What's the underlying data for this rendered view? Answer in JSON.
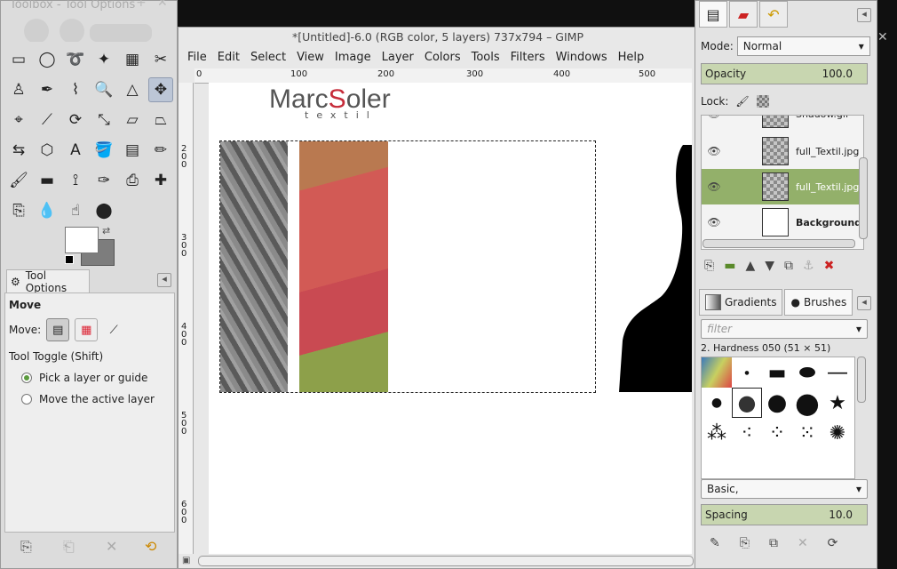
{
  "toolbox": {
    "title": "Toolbox - Tool Options",
    "tools": [
      {
        "name": "rect-select-icon",
        "glyph": "▭"
      },
      {
        "name": "ellipse-select-icon",
        "glyph": "◯"
      },
      {
        "name": "free-select-icon",
        "glyph": "➰"
      },
      {
        "name": "fuzzy-select-icon",
        "glyph": "✦"
      },
      {
        "name": "color-select-icon",
        "glyph": "▦"
      },
      {
        "name": "scissors-icon",
        "glyph": "✂"
      },
      {
        "name": "foreground-select-icon",
        "glyph": "♙"
      },
      {
        "name": "paths-icon",
        "glyph": "✒"
      },
      {
        "name": "color-picker-icon",
        "glyph": "⌇"
      },
      {
        "name": "zoom-icon",
        "glyph": "🔍"
      },
      {
        "name": "measure-icon",
        "glyph": "△"
      },
      {
        "name": "move-icon",
        "glyph": "✥"
      },
      {
        "name": "align-icon",
        "glyph": "⌖"
      },
      {
        "name": "crop-icon",
        "glyph": "⟋"
      },
      {
        "name": "rotate-icon",
        "glyph": "⟳"
      },
      {
        "name": "scale-icon",
        "glyph": "⤡"
      },
      {
        "name": "shear-icon",
        "glyph": "▱"
      },
      {
        "name": "perspective-icon",
        "glyph": "⏢"
      },
      {
        "name": "flip-icon",
        "glyph": "⇆"
      },
      {
        "name": "cage-transform-icon",
        "glyph": "⬡"
      },
      {
        "name": "text-icon",
        "glyph": "A"
      },
      {
        "name": "bucket-fill-icon",
        "glyph": "🪣"
      },
      {
        "name": "blend-icon",
        "glyph": "▤"
      },
      {
        "name": "pencil-icon",
        "glyph": "✏"
      },
      {
        "name": "paintbrush-icon",
        "glyph": "🖌"
      },
      {
        "name": "eraser-icon",
        "glyph": "▬"
      },
      {
        "name": "airbrush-icon",
        "glyph": "⟟"
      },
      {
        "name": "ink-icon",
        "glyph": "✑"
      },
      {
        "name": "clone-icon",
        "glyph": "⎙"
      },
      {
        "name": "heal-icon",
        "glyph": "✚"
      },
      {
        "name": "perspective-clone-icon",
        "glyph": "⎘"
      },
      {
        "name": "blur-icon",
        "glyph": "💧"
      },
      {
        "name": "smudge-icon",
        "glyph": "☝"
      },
      {
        "name": "dodge-burn-icon",
        "glyph": "⬤"
      }
    ],
    "active_tool": 11,
    "tool_options_tab": "Tool Options",
    "options": {
      "heading": "Move",
      "move_label": "Move:",
      "toggle_label": "Tool Toggle  (Shift)",
      "radio_pick": "Pick a layer or guide",
      "radio_move": "Move the active layer",
      "selected": "pick"
    }
  },
  "image_window": {
    "title": "*[Untitled]-6.0 (RGB color, 5 layers) 737x794 – GIMP",
    "menu": [
      "File",
      "Edit",
      "Select",
      "View",
      "Image",
      "Layer",
      "Colors",
      "Tools",
      "Filters",
      "Windows",
      "Help"
    ],
    "ruler_top": [
      "0",
      "100",
      "200",
      "300",
      "400",
      "500"
    ],
    "ruler_left": [
      "2\n0\n0",
      "3\n0\n0",
      "4\n0\n0",
      "5\n0\n0",
      "6\n0\n0"
    ],
    "logo_main_a": "Marc",
    "logo_accent_a": "S",
    "logo_main_b": "oler",
    "logo_sub": "textil"
  },
  "dock": {
    "mode_label": "Mode:",
    "mode_value": "Normal",
    "opacity_label": "Opacity",
    "opacity_value": "100.0",
    "lock_label": "Lock:",
    "layers": [
      {
        "name": "Shadow.gif",
        "eye": true,
        "thumb": "checker",
        "partial": true
      },
      {
        "name": "full_Textil.jpg",
        "eye": true,
        "thumb": "checker"
      },
      {
        "name": "full_Textil.jpg",
        "eye": true,
        "thumb": "checker",
        "active": true
      },
      {
        "name": "Background",
        "eye": true,
        "thumb": "white",
        "bold": true
      }
    ],
    "tab_gradients": "Gradients",
    "tab_brushes": "Brushes",
    "filter_placeholder": "filter",
    "brush_name": "2. Hardness 050 (51 × 51)",
    "brush_tag": "Basic,",
    "spacing_label": "Spacing",
    "spacing_value": "10.0"
  }
}
